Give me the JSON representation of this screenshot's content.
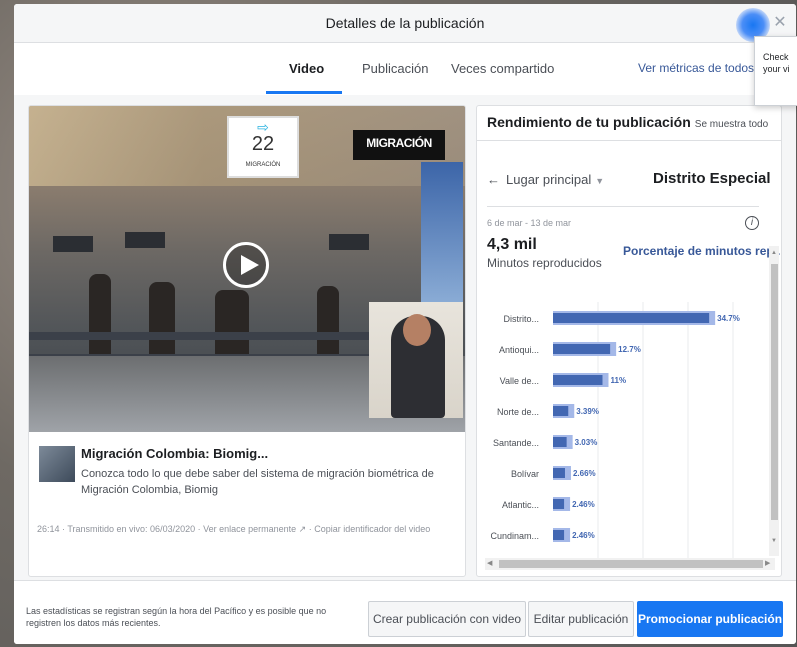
{
  "modal": {
    "title": "Detalles de la publicación",
    "close_icon": "close-icon",
    "tabs": [
      {
        "label": "Video",
        "active": true
      },
      {
        "label": "Publicación",
        "active": false
      },
      {
        "label": "Veces compartido",
        "active": false
      }
    ],
    "metrics_link": "Ver métricas de todos los"
  },
  "tooltip": {
    "line1": "Check",
    "line2": "your vi"
  },
  "video": {
    "sign_number": "22",
    "sign_small": "MIGRACIÓN",
    "logo_text": "MIGRACIÓN",
    "play_icon": "play-icon",
    "title": "Migración Colombia: Biomig...",
    "description": "Conozca todo lo que debe saber del sistema de migración biométrica de Migración Colombia, Biomig",
    "meta": "26:14 · Transmitido en vivo: 06/03/2020 · Ver enlace permanente ↗ · Copiar identificador del video"
  },
  "performance": {
    "title": "Rendimiento de tu publicación",
    "subtitle": "Se muestra todo",
    "dropdown_label": "Lugar principal",
    "region": "Distrito Especial",
    "date_range": "6 de mar - 13 de mar",
    "value": "4,3 mil",
    "value_label": "Minutos reproducidos",
    "percent_link": "Porcentaje de minutos rep.."
  },
  "chart_data": {
    "type": "bar",
    "orientation": "horizontal",
    "categories": [
      "Distrito...",
      "Antioqui...",
      "Valle de...",
      "Norte de...",
      "Santande...",
      "Bolívar",
      "Atlantic...",
      "Cundinam..."
    ],
    "values": [
      34.7,
      12.7,
      11,
      3.39,
      3.03,
      2.66,
      2.46,
      2.46
    ],
    "value_labels": [
      "34.7%",
      "12.7%",
      "11%",
      "3.39%",
      "3.03%",
      "2.66%",
      "2.46%",
      "2.46%"
    ],
    "xlim": [
      0,
      40
    ],
    "colors": {
      "bar": "#4267b2",
      "bar_light": "#a4b8e8"
    }
  },
  "footer": {
    "note": "Las estadísticas se registran según la hora del Pacífico y es posible que no registren los datos más recientes.",
    "buttons": {
      "create": "Crear publicación con video",
      "edit": "Editar publicación",
      "promote": "Promocionar publicación"
    }
  }
}
